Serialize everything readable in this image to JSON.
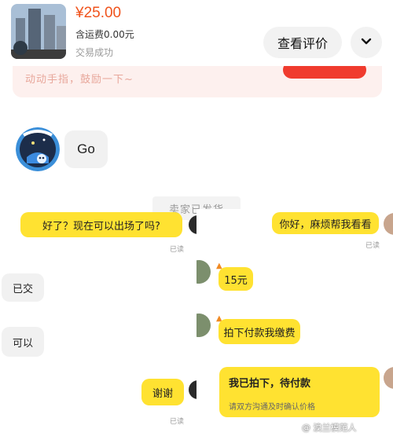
{
  "product": {
    "price": "¥25.00",
    "shipping": "含运费0.00元",
    "status": "交易成功",
    "review_button": "查看评价",
    "expand_icon": "chevron-down-icon"
  },
  "banner": {
    "text": "动动手指，鼓励一下~"
  },
  "left_chat": {
    "user_message": "Go",
    "system_tag": "卖家已发货",
    "messages": [
      {
        "text": "好了？现在可以出场了吗?",
        "side": "sent",
        "status": "已读"
      },
      {
        "text": "已交",
        "side": "received"
      },
      {
        "text": "可以",
        "side": "received"
      },
      {
        "text": "谢谢",
        "side": "sent",
        "status": "已读"
      }
    ]
  },
  "right_chat": {
    "messages": [
      {
        "text": "你好，麻烦帮我看看",
        "side": "sent",
        "status": "已读"
      },
      {
        "text": "15元",
        "side": "received"
      },
      {
        "text": "拍下付款我缴费",
        "side": "received"
      },
      {
        "text": "我已拍下，待付款",
        "side": "sent",
        "note": "请双方沟通及时确认价格"
      }
    ]
  },
  "watermark": "@ 溴兰模范人",
  "colors": {
    "price": "#f0531c",
    "bubble_yellow": "#ffe231",
    "bubble_gray": "#f1f1f1",
    "banner_button": "#f03b2e"
  }
}
